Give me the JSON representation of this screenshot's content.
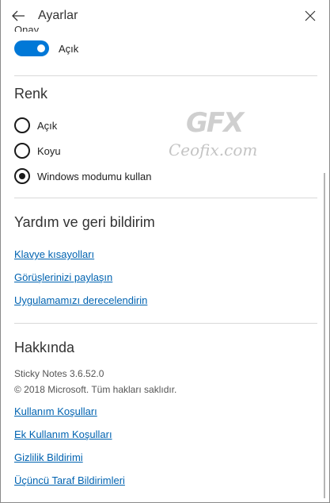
{
  "window": {
    "title": "Ayarlar",
    "back_icon": "arrow-left-icon",
    "close_icon": "close-icon"
  },
  "toggle_section": {
    "partial_label": "Onay",
    "toggle_state": "on",
    "toggle_label": "Açık",
    "accent_color": "#0078d7"
  },
  "color_section": {
    "title": "Renk",
    "options": [
      {
        "label": "Açık",
        "checked": false
      },
      {
        "label": "Koyu",
        "checked": false
      },
      {
        "label": "Windows modumu kullan",
        "checked": true
      }
    ]
  },
  "help_section": {
    "title": "Yardım ve geri bildirim",
    "links": [
      "Klavye kısayolları",
      "Görüşlerinizi paylaşın",
      "Uygulamamızı derecelendirin"
    ]
  },
  "about_section": {
    "title": "Hakkında",
    "version": "Sticky Notes 3.6.52.0",
    "copyright": "© 2018 Microsoft. Tüm hakları saklıdır.",
    "links": [
      "Kullanım Koşulları",
      "Ek Kullanım Koşulları",
      "Gizlilik Bildirimi",
      "Üçüncü Taraf Bildirimleri"
    ]
  },
  "watermark": {
    "logo": "GFX",
    "text": "Ceofix.com"
  },
  "colors": {
    "link": "#0063b1",
    "divider": "#d9d9d9"
  }
}
